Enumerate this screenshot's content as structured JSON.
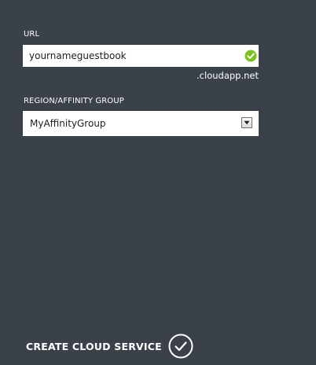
{
  "form": {
    "url": {
      "label": "URL",
      "value": "yournameguestbook",
      "suffix": ".cloudapp.net",
      "status_icon": "check-circle-icon",
      "status_color": "#7cc21f"
    },
    "region": {
      "label": "REGION/AFFINITY GROUP",
      "selected": "MyAffinityGroup",
      "dropdown_icon": "chevron-down-icon"
    }
  },
  "footer": {
    "action_label": "CREATE CLOUD SERVICE",
    "action_icon": "checkmark-circle-icon"
  },
  "colors": {
    "background": "#3a4149",
    "input_background": "#ffffff",
    "text": "#ffffff",
    "input_text": "#1e1e1e"
  }
}
